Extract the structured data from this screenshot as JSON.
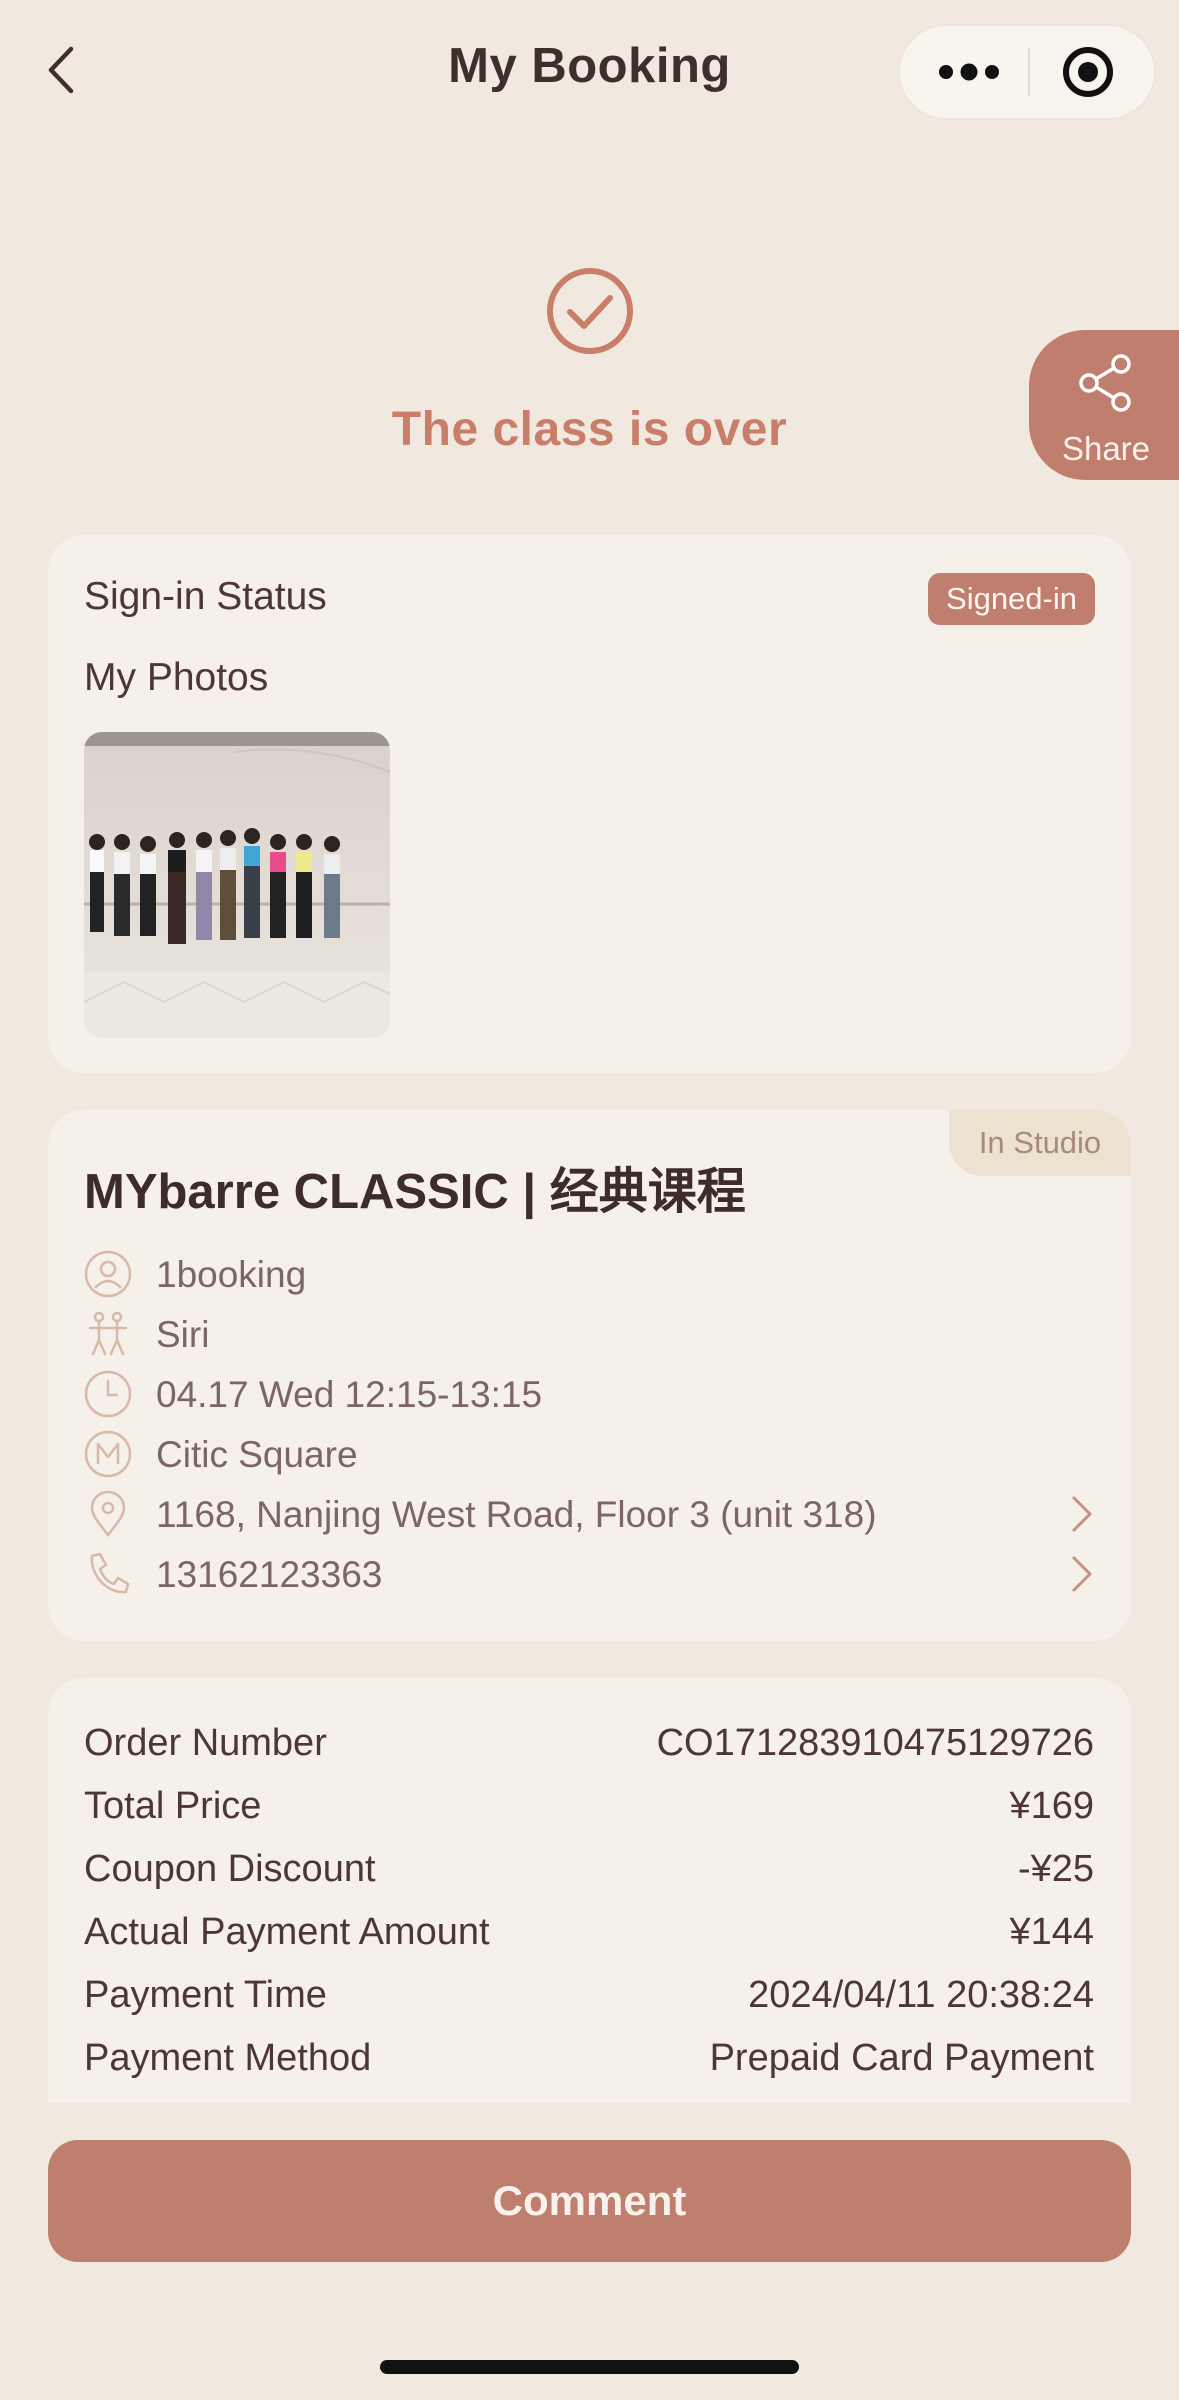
{
  "header": {
    "title": "My Booking"
  },
  "status": {
    "text": "The class is over"
  },
  "share": {
    "label": "Share"
  },
  "signin_card": {
    "status_label": "Sign-in Status",
    "status_badge": "Signed-in",
    "photos_label": "My Photos"
  },
  "class_card": {
    "tag": "In Studio",
    "title": "MYbarre CLASSIC | 经典课程",
    "booker": "1booking",
    "instructor": "Siri",
    "time": "04.17 Wed 12:15-13:15",
    "studio": "Citic Square",
    "address": "1168, Nanjing West Road, Floor 3 (unit 318)",
    "phone": "13162123363"
  },
  "order_card": {
    "rows": [
      {
        "key": "Order Number",
        "value": "CO171283910475129726"
      },
      {
        "key": "Total Price",
        "value": "¥169"
      },
      {
        "key": "Coupon Discount",
        "value": "-¥25"
      },
      {
        "key": "Actual Payment Amount",
        "value": "¥144"
      },
      {
        "key": "Payment Time",
        "value": "2024/04/11 20:38:24"
      },
      {
        "key": "Payment Method",
        "value": "Prepaid Card Payment"
      }
    ]
  },
  "actions": {
    "comment_label": "Comment"
  },
  "colors": {
    "background": "#f1e9df",
    "accent": "#c07f6e",
    "card": "#f5f0e9",
    "text_dark": "#4d3733",
    "text_muted": "#7b6660"
  }
}
